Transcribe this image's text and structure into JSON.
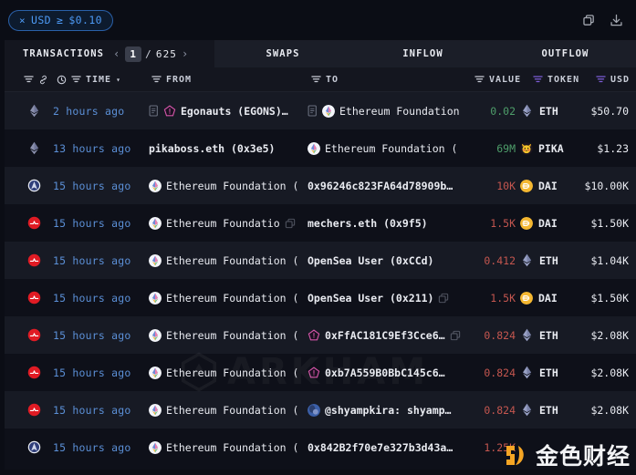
{
  "filter_chip": {
    "close": "×",
    "label": "USD",
    "operator": "≥",
    "value": "$0.10"
  },
  "topbar_actions": [
    {
      "name": "copy-icon",
      "title": "Copy"
    },
    {
      "name": "download-icon",
      "title": "Download"
    }
  ],
  "tabs": [
    {
      "label": "TRANSACTIONS",
      "active": true
    },
    {
      "label": "SWAPS",
      "active": false
    },
    {
      "label": "INFLOW",
      "active": false
    },
    {
      "label": "OUTFLOW",
      "active": false
    }
  ],
  "pager": {
    "prev": "‹",
    "current": "1",
    "separator": "/",
    "total": "625",
    "next": "›"
  },
  "columns": [
    {
      "key": "time",
      "label": "TIME",
      "filter_color": "#c9cdd8",
      "sort": "▾"
    },
    {
      "key": "from",
      "label": "FROM",
      "filter_color": "#c9cdd8"
    },
    {
      "key": "to",
      "label": "TO",
      "filter_color": "#c9cdd8"
    },
    {
      "key": "value",
      "label": "VALUE",
      "filter_color": "#c9cdd8"
    },
    {
      "key": "token",
      "label": "TOKEN",
      "filter_color": "#7c5cd6"
    },
    {
      "key": "usd",
      "label": "USD",
      "filter_color": "#7c5cd6"
    }
  ],
  "colors": {
    "accent_blue": "#4d9af5",
    "time_blue": "#5b8fd6",
    "positive_green": "#4e9e6a",
    "negative_red": "#c4564f",
    "token_purple": "#7c5cd6",
    "row_bg": "#0e1019",
    "row_bg_alt": "#171a24",
    "page_bg": "#0b0d15"
  },
  "watermarks": {
    "arkham": "ARKHAM",
    "logo_text": "金色财经"
  },
  "rows": [
    {
      "chain_icon": "ethereum-chain-icon",
      "chain_kind": "eth",
      "time": "2 hours ago",
      "from": {
        "doc": true,
        "icon": "nft-pentagon-icon",
        "icon_kind": "pink-pentagon",
        "label": "Egonauts (EGONS)…",
        "bold": true,
        "copy": false
      },
      "to": {
        "doc": true,
        "icon": "ethereum-foundation-icon",
        "icon_kind": "ef",
        "label": "Ethereum Foundation",
        "bold": false,
        "copy": false
      },
      "value": "0.02",
      "value_sign": "pos",
      "token": "ETH",
      "token_icon": "eth-token-icon",
      "token_kind": "eth",
      "usd": "$50.70",
      "alt": true
    },
    {
      "chain_icon": "ethereum-chain-icon",
      "chain_kind": "eth",
      "time": "13 hours ago",
      "from": {
        "doc": false,
        "icon": null,
        "icon_kind": null,
        "label": "pikaboss.eth (0x3e5)",
        "bold": true,
        "copy": false
      },
      "to": {
        "doc": false,
        "icon": "ethereum-foundation-icon",
        "icon_kind": "ef",
        "label": "Ethereum Foundation (",
        "bold": false,
        "copy": false
      },
      "value": "69M",
      "value_sign": "pos",
      "token": "PIKA",
      "token_icon": "pika-token-icon",
      "token_kind": "pika",
      "usd": "$1.23",
      "alt": false
    },
    {
      "chain_icon": "arbitrum-chain-icon",
      "chain_kind": "blue",
      "time": "15 hours ago",
      "from": {
        "doc": false,
        "icon": "ethereum-foundation-icon",
        "icon_kind": "ef",
        "label": "Ethereum Foundation (",
        "bold": false,
        "copy": false
      },
      "to": {
        "doc": false,
        "icon": null,
        "icon_kind": null,
        "label": "0x96246c823FA64d78909b…",
        "bold": true,
        "copy": false
      },
      "value": "10K",
      "value_sign": "neg",
      "token": "DAI",
      "token_icon": "dai-token-icon",
      "token_kind": "dai",
      "usd": "$10.00K",
      "alt": true
    },
    {
      "chain_icon": "opensea-chain-icon",
      "chain_kind": "red",
      "time": "15 hours ago",
      "from": {
        "doc": false,
        "icon": "ethereum-foundation-icon",
        "icon_kind": "ef",
        "label": "Ethereum Foundatio",
        "bold": false,
        "copy": true
      },
      "to": {
        "doc": false,
        "icon": null,
        "icon_kind": null,
        "label": "mechers.eth (0x9f5)",
        "bold": true,
        "copy": false
      },
      "value": "1.5K",
      "value_sign": "neg",
      "token": "DAI",
      "token_icon": "dai-token-icon",
      "token_kind": "dai",
      "usd": "$1.50K",
      "alt": false
    },
    {
      "chain_icon": "opensea-chain-icon",
      "chain_kind": "red",
      "time": "15 hours ago",
      "from": {
        "doc": false,
        "icon": "ethereum-foundation-icon",
        "icon_kind": "ef",
        "label": "Ethereum Foundation (",
        "bold": false,
        "copy": false
      },
      "to": {
        "doc": false,
        "icon": null,
        "icon_kind": null,
        "label": "OpenSea User (0xCCd)",
        "bold": true,
        "copy": false
      },
      "value": "0.412",
      "value_sign": "neg",
      "token": "ETH",
      "token_icon": "eth-token-icon",
      "token_kind": "eth",
      "usd": "$1.04K",
      "alt": true
    },
    {
      "chain_icon": "opensea-chain-icon",
      "chain_kind": "red",
      "time": "15 hours ago",
      "from": {
        "doc": false,
        "icon": "ethereum-foundation-icon",
        "icon_kind": "ef",
        "label": "Ethereum Foundation (",
        "bold": false,
        "copy": false
      },
      "to": {
        "doc": false,
        "icon": null,
        "icon_kind": null,
        "label": "OpenSea User (0x211)",
        "bold": true,
        "copy": true
      },
      "value": "1.5K",
      "value_sign": "neg",
      "token": "DAI",
      "token_icon": "dai-token-icon",
      "token_kind": "dai",
      "usd": "$1.50K",
      "alt": false
    },
    {
      "chain_icon": "opensea-chain-icon",
      "chain_kind": "red",
      "time": "15 hours ago",
      "from": {
        "doc": false,
        "icon": "ethereum-foundation-icon",
        "icon_kind": "ef",
        "label": "Ethereum Foundation (",
        "bold": false,
        "copy": false
      },
      "to": {
        "doc": false,
        "icon": "nft-pentagon-icon",
        "icon_kind": "pink-pentagon",
        "label": "0xFfAC181C9Ef3Cce6…",
        "bold": true,
        "copy": true
      },
      "value": "0.824",
      "value_sign": "neg",
      "token": "ETH",
      "token_icon": "eth-token-icon",
      "token_kind": "eth",
      "usd": "$2.08K",
      "alt": true
    },
    {
      "chain_icon": "opensea-chain-icon",
      "chain_kind": "red",
      "time": "15 hours ago",
      "from": {
        "doc": false,
        "icon": "ethereum-foundation-icon",
        "icon_kind": "ef",
        "label": "Ethereum Foundation (",
        "bold": false,
        "copy": false
      },
      "to": {
        "doc": false,
        "icon": "nft-pentagon-icon",
        "icon_kind": "pink-pentagon",
        "label": "0xb7A559B0BbC145c6…",
        "bold": true,
        "copy": false
      },
      "value": "0.824",
      "value_sign": "neg",
      "token": "ETH",
      "token_icon": "eth-token-icon",
      "token_kind": "eth",
      "usd": "$2.08K",
      "alt": false
    },
    {
      "chain_icon": "opensea-chain-icon",
      "chain_kind": "red",
      "time": "15 hours ago",
      "from": {
        "doc": false,
        "icon": "ethereum-foundation-icon",
        "icon_kind": "ef",
        "label": "Ethereum Foundation (",
        "bold": false,
        "copy": false
      },
      "to": {
        "doc": false,
        "icon": "twitter-avatar-icon",
        "icon_kind": "avatar",
        "label": "@shyampkira: shyamp…",
        "bold": true,
        "copy": false
      },
      "value": "0.824",
      "value_sign": "neg",
      "token": "ETH",
      "token_icon": "eth-token-icon",
      "token_kind": "eth",
      "usd": "$2.08K",
      "alt": true
    },
    {
      "chain_icon": "arbitrum-chain-icon",
      "chain_kind": "blue",
      "time": "15 hours ago",
      "from": {
        "doc": false,
        "icon": "ethereum-foundation-icon",
        "icon_kind": "ef",
        "label": "Ethereum Foundation (",
        "bold": false,
        "copy": false
      },
      "to": {
        "doc": false,
        "icon": null,
        "icon_kind": null,
        "label": "0x842B2f70e7e327b3d43a…",
        "bold": true,
        "copy": false
      },
      "value": "1.25K",
      "value_sign": "neg",
      "token": "",
      "token_icon": null,
      "token_kind": null,
      "usd": "",
      "alt": false
    }
  ]
}
